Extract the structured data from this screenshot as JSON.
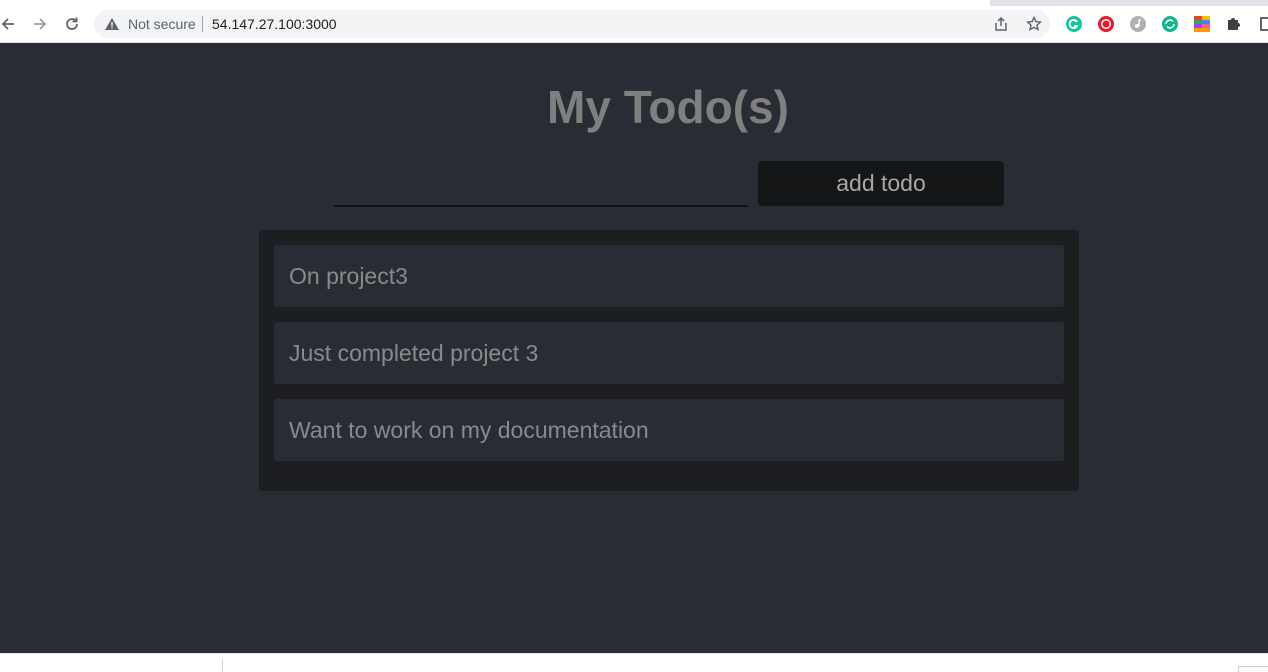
{
  "browser": {
    "security_label": "Not secure",
    "url": "54.147.27.100:3000",
    "icons": {
      "back": "back-arrow-icon",
      "forward": "forward-arrow-icon",
      "reload": "reload-icon",
      "warning": "warning-triangle-icon",
      "share": "share-icon",
      "bookmark": "star-icon",
      "extensions": [
        "grammarly-icon",
        "red-record-icon",
        "grey-music-icon",
        "green-sync-icon",
        "colorful-grid-icon",
        "puzzle-icon",
        "side-panel-icon"
      ]
    }
  },
  "app": {
    "title": "My Todo(s)",
    "input": {
      "value": "",
      "placeholder": ""
    },
    "add_button_label": "add todo",
    "todos": [
      {
        "text": "On project3"
      },
      {
        "text": "Just completed project 3"
      },
      {
        "text": "Want to work on my documentation"
      }
    ]
  },
  "colors": {
    "page_background": "#282c34",
    "panel_background": "#1c1e22",
    "button_background": "#141618",
    "text_muted": "#7f7f7f"
  }
}
